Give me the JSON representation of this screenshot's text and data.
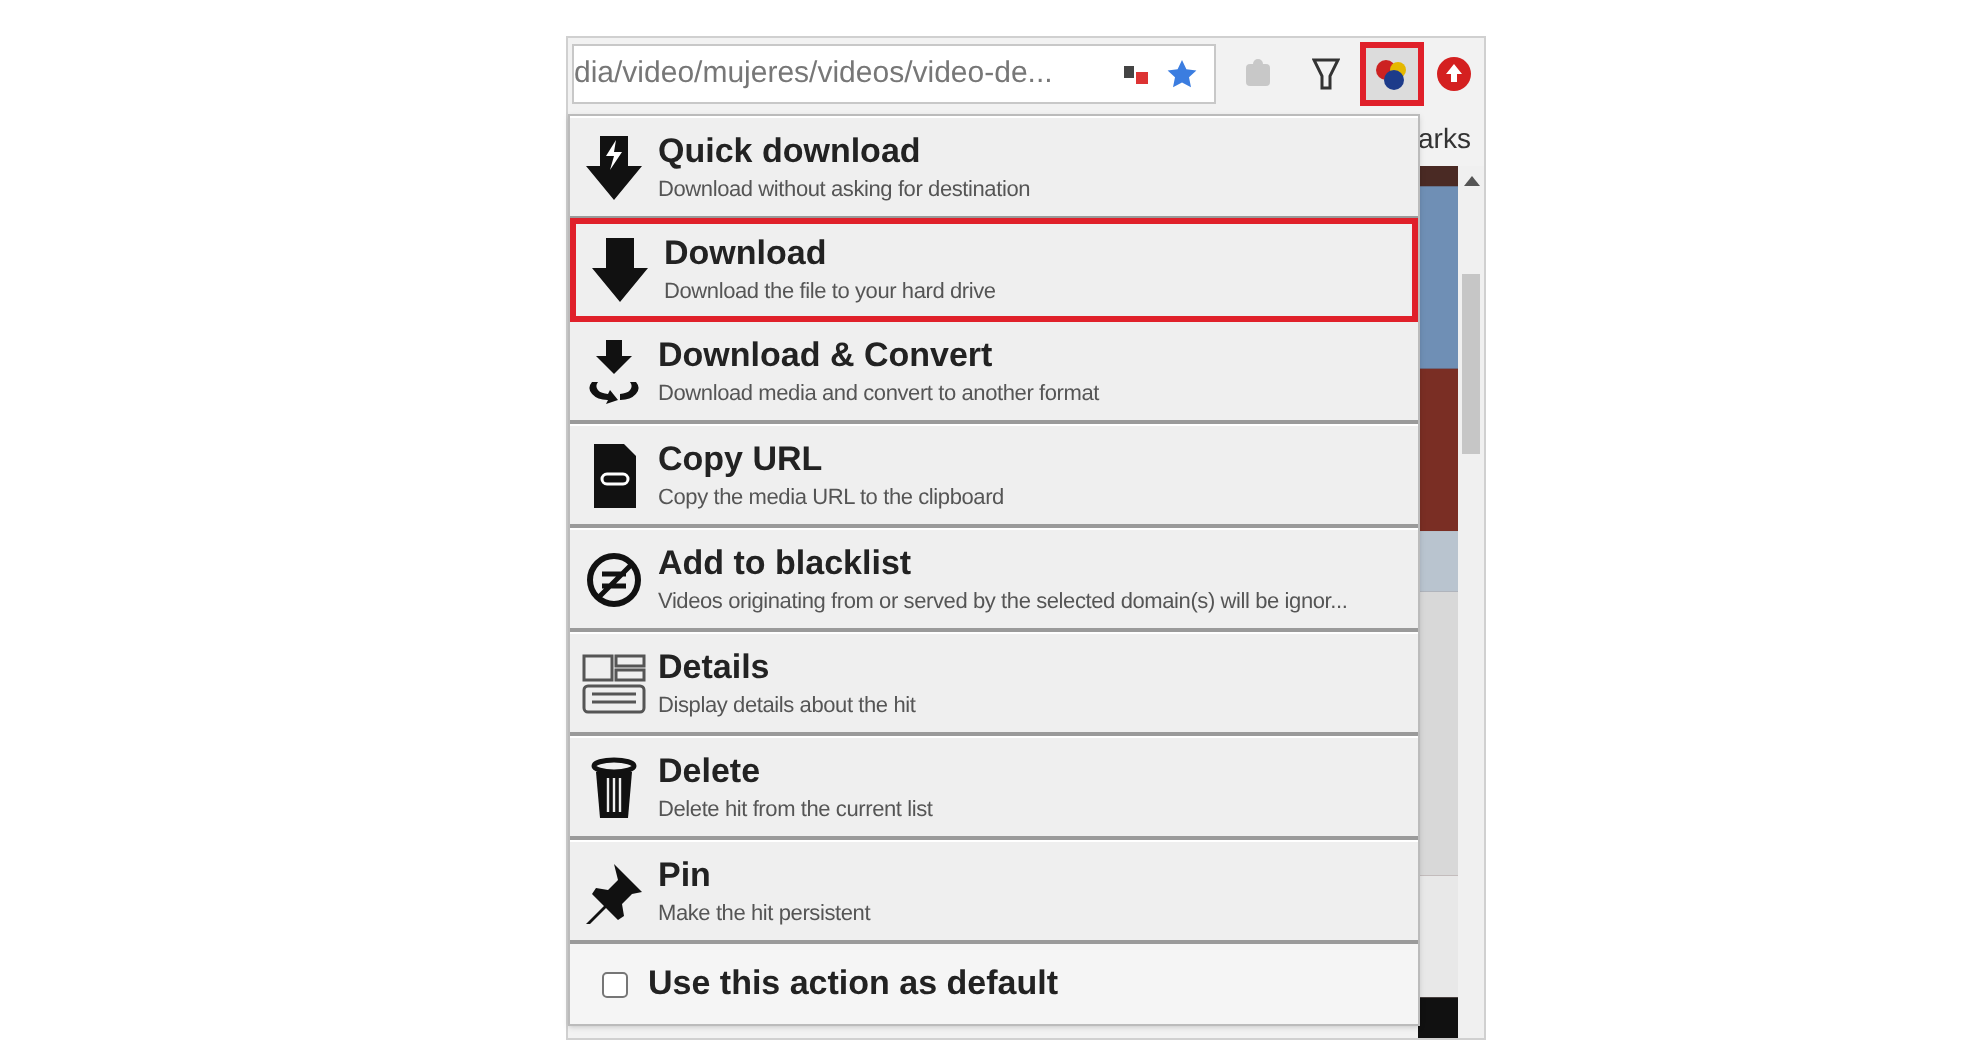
{
  "address_bar": {
    "url": "dia/video/mujeres/videos/video-de..."
  },
  "toolbar": {
    "extension_highlighted": true
  },
  "bookmarks_bar": {
    "text": "arks"
  },
  "menu": {
    "items": [
      {
        "title": "Quick download",
        "description": "Download without asking for destination",
        "highlighted": false
      },
      {
        "title": "Download",
        "description": "Download the file to your hard drive",
        "highlighted": true
      },
      {
        "title": "Download & Convert",
        "description": "Download media and convert to another format",
        "highlighted": false
      },
      {
        "title": "Copy URL",
        "description": "Copy the media URL to the clipboard",
        "highlighted": false
      },
      {
        "title": "Add to blacklist",
        "description": "Videos originating from or served by the selected domain(s) will be ignor...",
        "highlighted": false
      },
      {
        "title": "Details",
        "description": "Display details about the hit",
        "highlighted": false
      },
      {
        "title": "Delete",
        "description": "Delete hit from the current list",
        "highlighted": false
      },
      {
        "title": "Pin",
        "description": "Make the hit persistent",
        "highlighted": false
      }
    ],
    "default_option": {
      "label": "Use this action as default",
      "checked": false
    }
  }
}
